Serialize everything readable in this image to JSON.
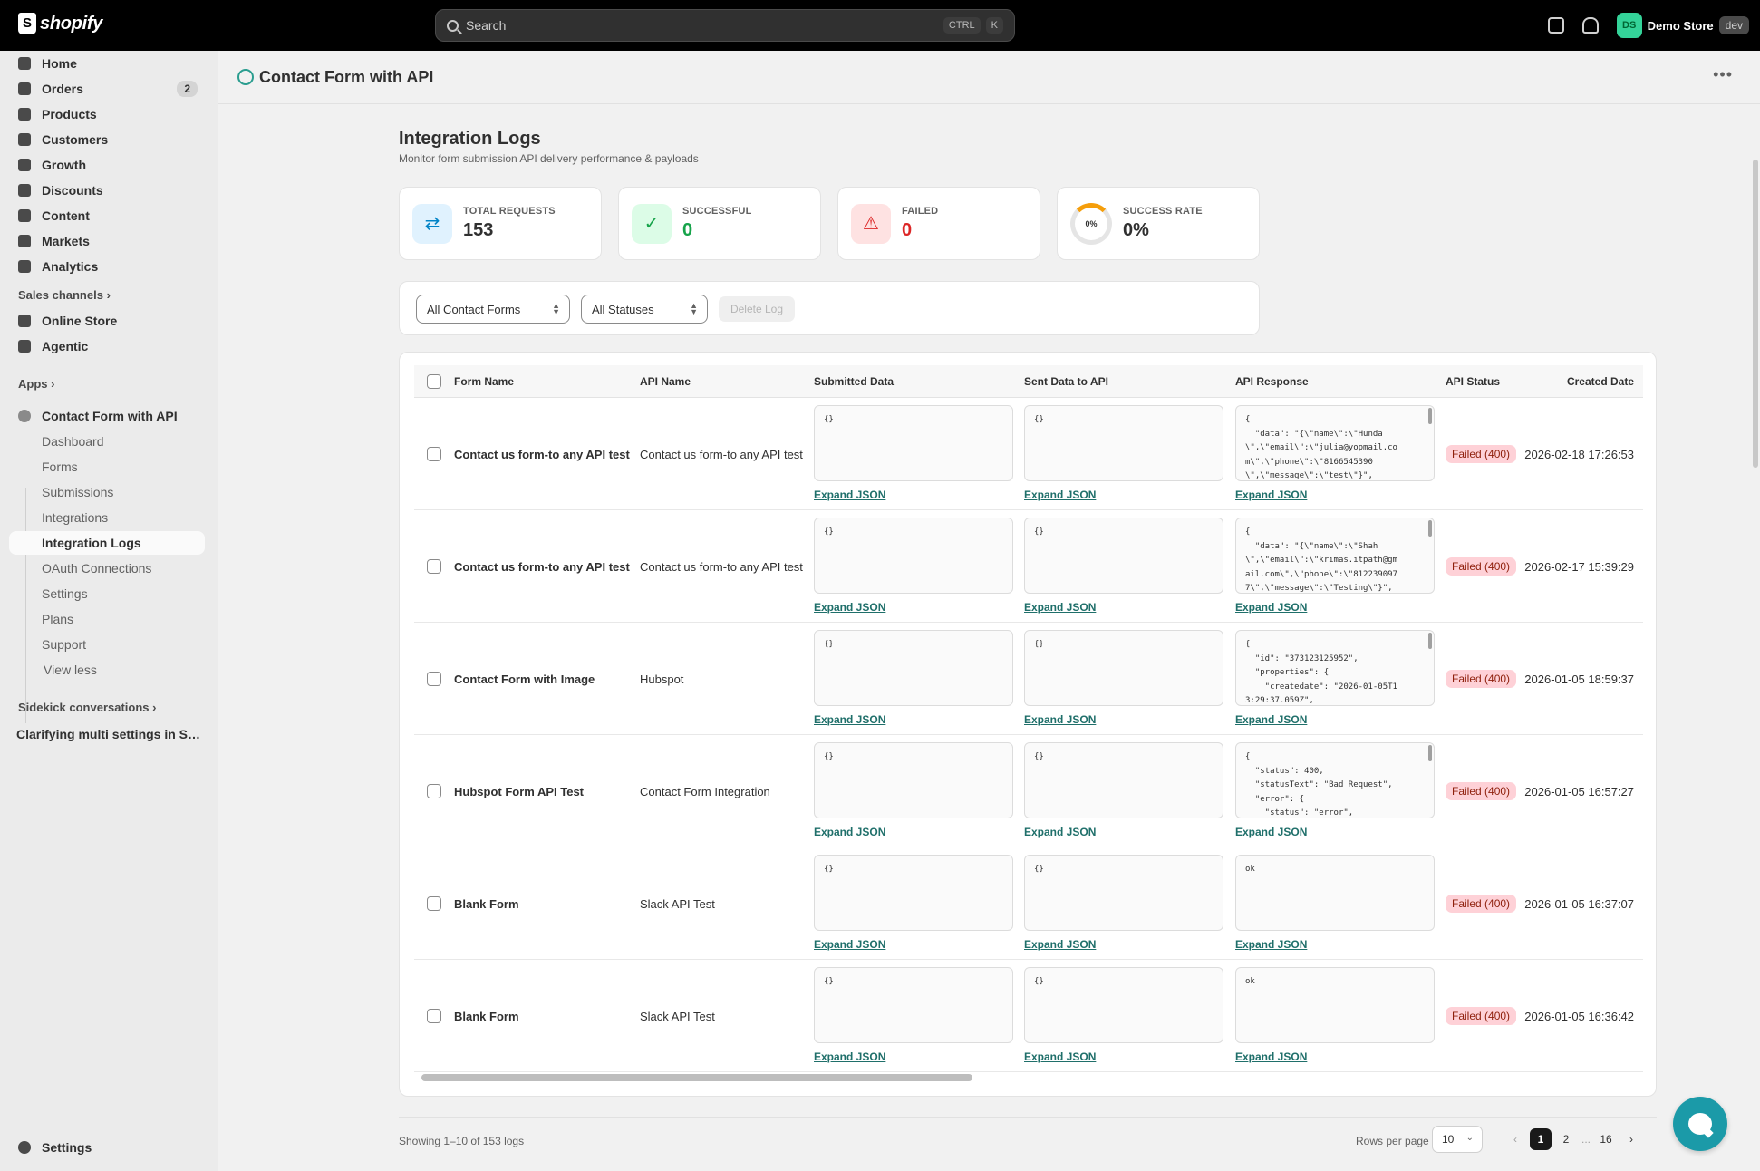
{
  "topbar": {
    "logo": "shopify",
    "search_placeholder": "Search",
    "kbd1": "CTRL",
    "kbd2": "K",
    "store_initials": "DS",
    "store_name": "Demo Store",
    "store_env": "dev"
  },
  "sidebar": {
    "items": [
      {
        "label": "Home",
        "icon": "home-icon"
      },
      {
        "label": "Orders",
        "icon": "orders-icon",
        "badge": "2"
      },
      {
        "label": "Products",
        "icon": "tag-icon"
      },
      {
        "label": "Customers",
        "icon": "person-icon"
      },
      {
        "label": "Growth",
        "icon": "growth-icon"
      },
      {
        "label": "Discounts",
        "icon": "discount-icon"
      },
      {
        "label": "Content",
        "icon": "content-icon"
      },
      {
        "label": "Markets",
        "icon": "globe-icon"
      },
      {
        "label": "Analytics",
        "icon": "bar-chart-icon"
      }
    ],
    "sales_channels": "Sales channels",
    "channels": [
      {
        "label": "Online Store",
        "icon": "store-icon"
      },
      {
        "label": "Agentic",
        "icon": "agentic-icon"
      }
    ],
    "apps": "Apps",
    "app_name": "Contact Form with API",
    "app_sub": [
      "Dashboard",
      "Forms",
      "Submissions",
      "Integrations",
      "Integration Logs",
      "OAuth Connections",
      "Settings",
      "Plans",
      "Support",
      "View less"
    ],
    "sidekick": "Sidekick conversations",
    "conversation": "Clarifying multi settings in Sho...",
    "settings": "Settings"
  },
  "header": {
    "title": "Contact Form with API"
  },
  "page": {
    "title": "Integration Logs",
    "subtitle": "Monitor form submission API delivery performance & payloads"
  },
  "stats": [
    {
      "label": "TOTAL REQUESTS",
      "value": "153",
      "icon": "arrows-icon",
      "color": "#303030"
    },
    {
      "label": "SUCCESSFUL",
      "value": "0",
      "icon": "check-icon",
      "color": "#16a34a"
    },
    {
      "label": "FAILED",
      "value": "0",
      "icon": "warning-icon",
      "color": "#dc2626"
    },
    {
      "label": "SUCCESS RATE",
      "value": "0%",
      "ring": "0%"
    }
  ],
  "filters": {
    "forms": "All Contact Forms",
    "statuses": "All Statuses",
    "delete": "Delete Log"
  },
  "table": {
    "columns": [
      "Form Name",
      "API Name",
      "Submitted Data",
      "Sent Data to API",
      "API Response",
      "API Status",
      "Created Date"
    ],
    "expand_label": "Expand JSON",
    "rows": [
      {
        "form": "Contact us form-to any API test",
        "api": "Contact us form-to any API test",
        "submitted": "{}",
        "sent": "{}",
        "response": "{\n  \"data\": \"{\\\"name\\\":\\\"Hunda\n\\\",\\\"email\\\":\\\"julia@yopmail.co\nm\\\",\\\"phone\\\":\\\"8166545390\n\\\",\\\"message\\\":\\\"test\\\"}\",",
        "status": "Failed (400)",
        "date": "2026-02-18 17:26:53"
      },
      {
        "form": "Contact us form-to any API test",
        "api": "Contact us form-to any API test",
        "submitted": "{}",
        "sent": "{}",
        "response": "{\n  \"data\": \"{\\\"name\\\":\\\"Shah\n\\\",\\\"email\\\":\\\"krimas.itpath@gm\nail.com\\\",\\\"phone\\\":\\\"812239097\n7\\\",\\\"message\\\":\\\"Testing\\\"}\",",
        "status": "Failed (400)",
        "date": "2026-02-17 15:39:29"
      },
      {
        "form": "Contact Form with Image",
        "api": "Hubspot",
        "submitted": "{}",
        "sent": "{}",
        "response": "{\n  \"id\": \"373123125952\",\n  \"properties\": {\n    \"createdate\": \"2026-01-05T1\n3:29:37.059Z\",",
        "status": "Failed (400)",
        "date": "2026-01-05 18:59:37"
      },
      {
        "form": "Hubspot Form API Test",
        "api": "Contact Form Integration",
        "submitted": "{}",
        "sent": "{}",
        "response": "{\n  \"status\": 400,\n  \"statusText\": \"Bad Request\",\n  \"error\": {\n    \"status\": \"error\",",
        "status": "Failed (400)",
        "date": "2026-01-05 16:57:27"
      },
      {
        "form": "Blank Form",
        "api": "Slack API Test",
        "submitted": "{}",
        "sent": "{}",
        "response": "ok",
        "status": "Failed (400)",
        "date": "2026-01-05 16:37:07"
      },
      {
        "form": "Blank Form",
        "api": "Slack API Test",
        "submitted": "{}",
        "sent": "{}",
        "response": "ok",
        "status": "Failed (400)",
        "date": "2026-01-05 16:36:42"
      }
    ]
  },
  "footer": {
    "showing": "Showing 1–10 of 153 logs",
    "rows_per_page": "Rows per page",
    "rows_value": "10",
    "pages": [
      "1",
      "2",
      "...",
      "16"
    ]
  }
}
